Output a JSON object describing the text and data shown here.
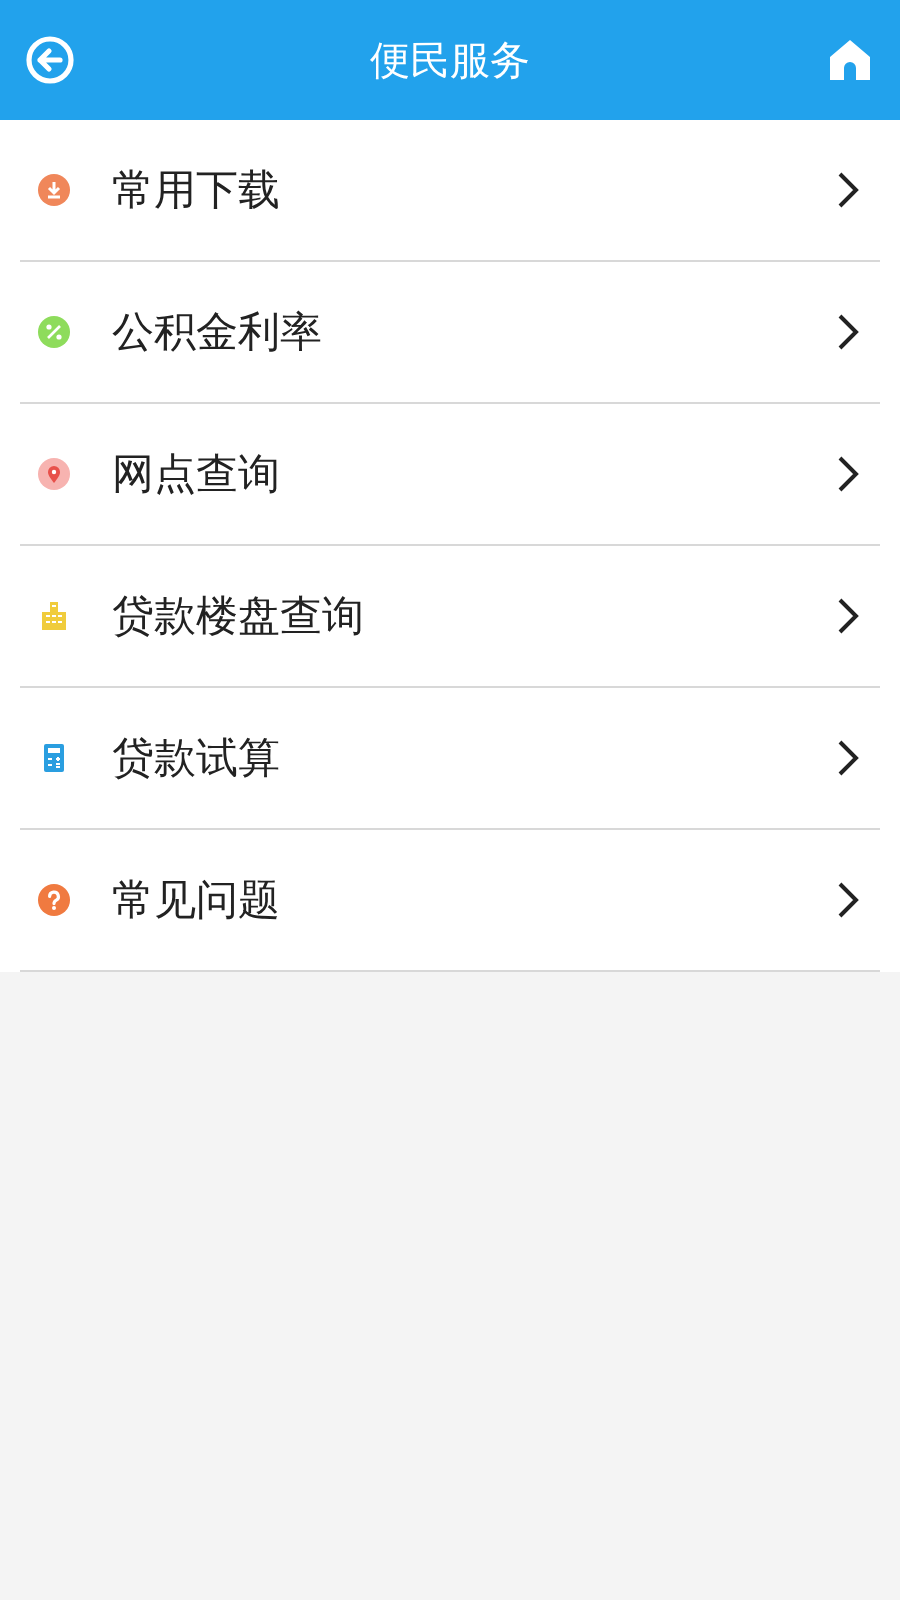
{
  "header": {
    "title": "便民服务"
  },
  "items": [
    {
      "label": "常用下载",
      "kind": "download",
      "color": "#f0875a"
    },
    {
      "label": "公积金利率",
      "kind": "percent",
      "color": "#8edc5c"
    },
    {
      "label": "网点查询",
      "kind": "pin",
      "color": "#f7b3b0"
    },
    {
      "label": "贷款楼盘查询",
      "kind": "building",
      "color": "#f0cc3c"
    },
    {
      "label": "贷款试算",
      "kind": "calculator",
      "color": "#2a9ee0"
    },
    {
      "label": "常见问题",
      "kind": "question",
      "color": "#f07a40"
    }
  ]
}
